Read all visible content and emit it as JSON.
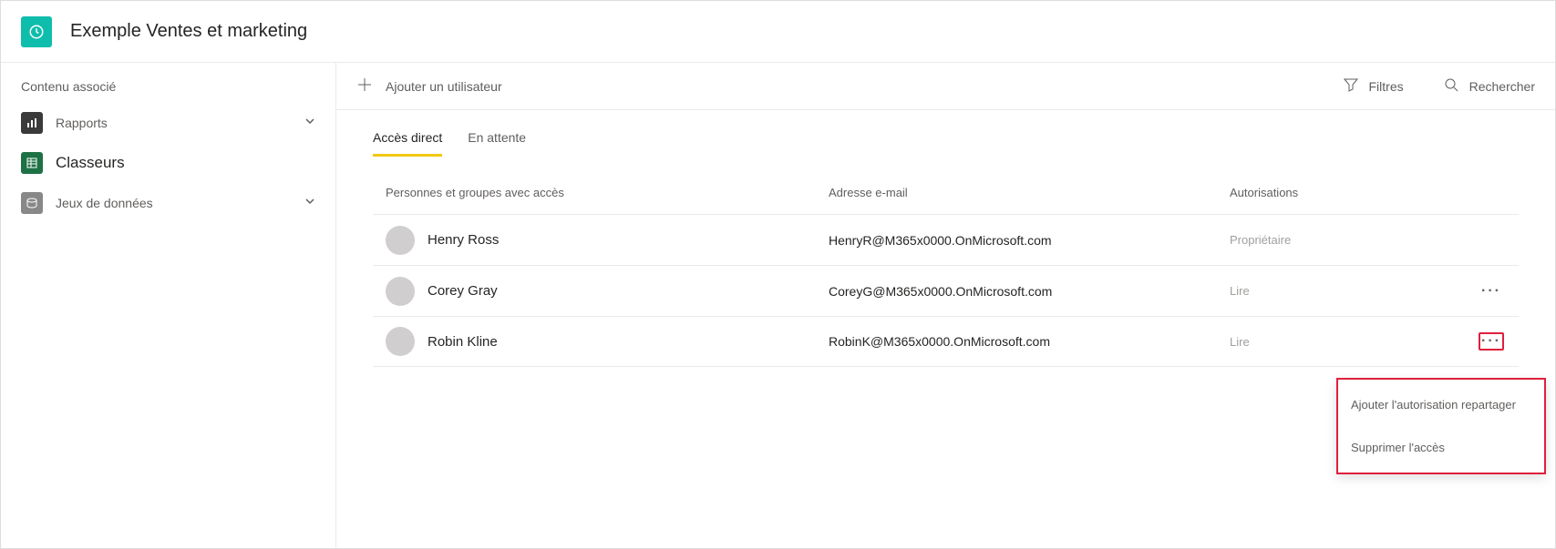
{
  "header": {
    "title": "Exemple Ventes et marketing"
  },
  "sidebar": {
    "heading": "Contenu associé",
    "items": [
      {
        "label": "Rapports",
        "expandable": true
      },
      {
        "label": "Classeurs",
        "expandable": false
      },
      {
        "label": "Jeux de données",
        "expandable": true
      }
    ]
  },
  "toolbar": {
    "add_user_label": "Ajouter un utilisateur",
    "filters_label": "Filtres",
    "search_label": "Rechercher"
  },
  "tabs": [
    {
      "label": "Accès direct",
      "active": true
    },
    {
      "label": "En attente",
      "active": false
    }
  ],
  "table": {
    "headers": {
      "name": "Personnes et groupes avec accès",
      "email": "Adresse e-mail",
      "perm": "Autorisations"
    },
    "rows": [
      {
        "name": "Henry Ross",
        "email": "HenryR@M365x0000.OnMicrosoft.com",
        "perm": "Propriétaire",
        "show_more": false
      },
      {
        "name": "Corey Gray",
        "email": "CoreyG@M365x0000.OnMicrosoft.com",
        "perm": "Lire",
        "show_more": true
      },
      {
        "name": "Robin Kline",
        "email": "RobinK@M365x0000.OnMicrosoft.com",
        "perm": "Lire",
        "show_more": true,
        "highlight": true
      }
    ]
  },
  "context_menu": {
    "items": [
      "Ajouter l'autorisation repartager",
      "Supprimer l'accès"
    ]
  }
}
